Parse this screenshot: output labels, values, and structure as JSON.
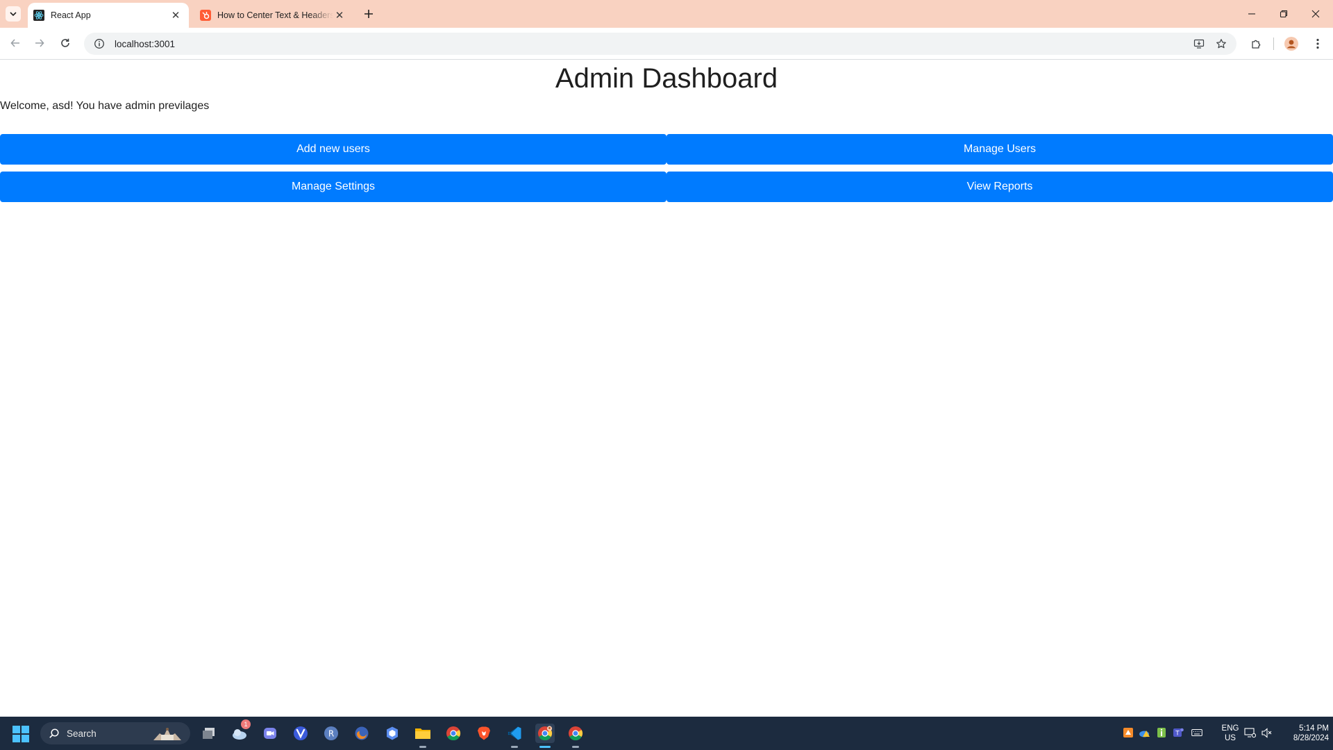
{
  "browser": {
    "tabs": [
      {
        "title": "React App",
        "active": true,
        "favicon": "react-icon"
      },
      {
        "title": "How to Center Text & Headers in CSS",
        "active": false,
        "favicon": "hubspot-icon"
      }
    ],
    "address": "localhost:3001"
  },
  "page": {
    "title": "Admin Dashboard",
    "welcome": "Welcome, asd! You have admin previlages",
    "buttons": {
      "add_users": "Add new users",
      "manage_users": "Manage Users",
      "manage_settings": "Manage Settings",
      "view_reports": "View Reports"
    },
    "button_color": "#007bff"
  },
  "taskbar": {
    "search_placeholder": "Search",
    "apps": [
      "file-explorer-icon",
      "weather-icon",
      "teams-icon",
      "vivaldi-icon",
      "r-app-icon",
      "firefox-icon",
      "security-icon",
      "folder-icon",
      "chrome-icon",
      "brave-icon",
      "vscode-icon",
      "chrome-dev-icon",
      "chrome-icon"
    ],
    "weather_badge": "1",
    "language": {
      "line1": "ENG",
      "line2": "US"
    },
    "clock": {
      "time": "5:14 PM",
      "date": "8/28/2024"
    }
  },
  "colors": {
    "tabstrip": "#f9d2c1",
    "taskbar": "#1c2b3f",
    "accent": "#4cc2ff"
  }
}
